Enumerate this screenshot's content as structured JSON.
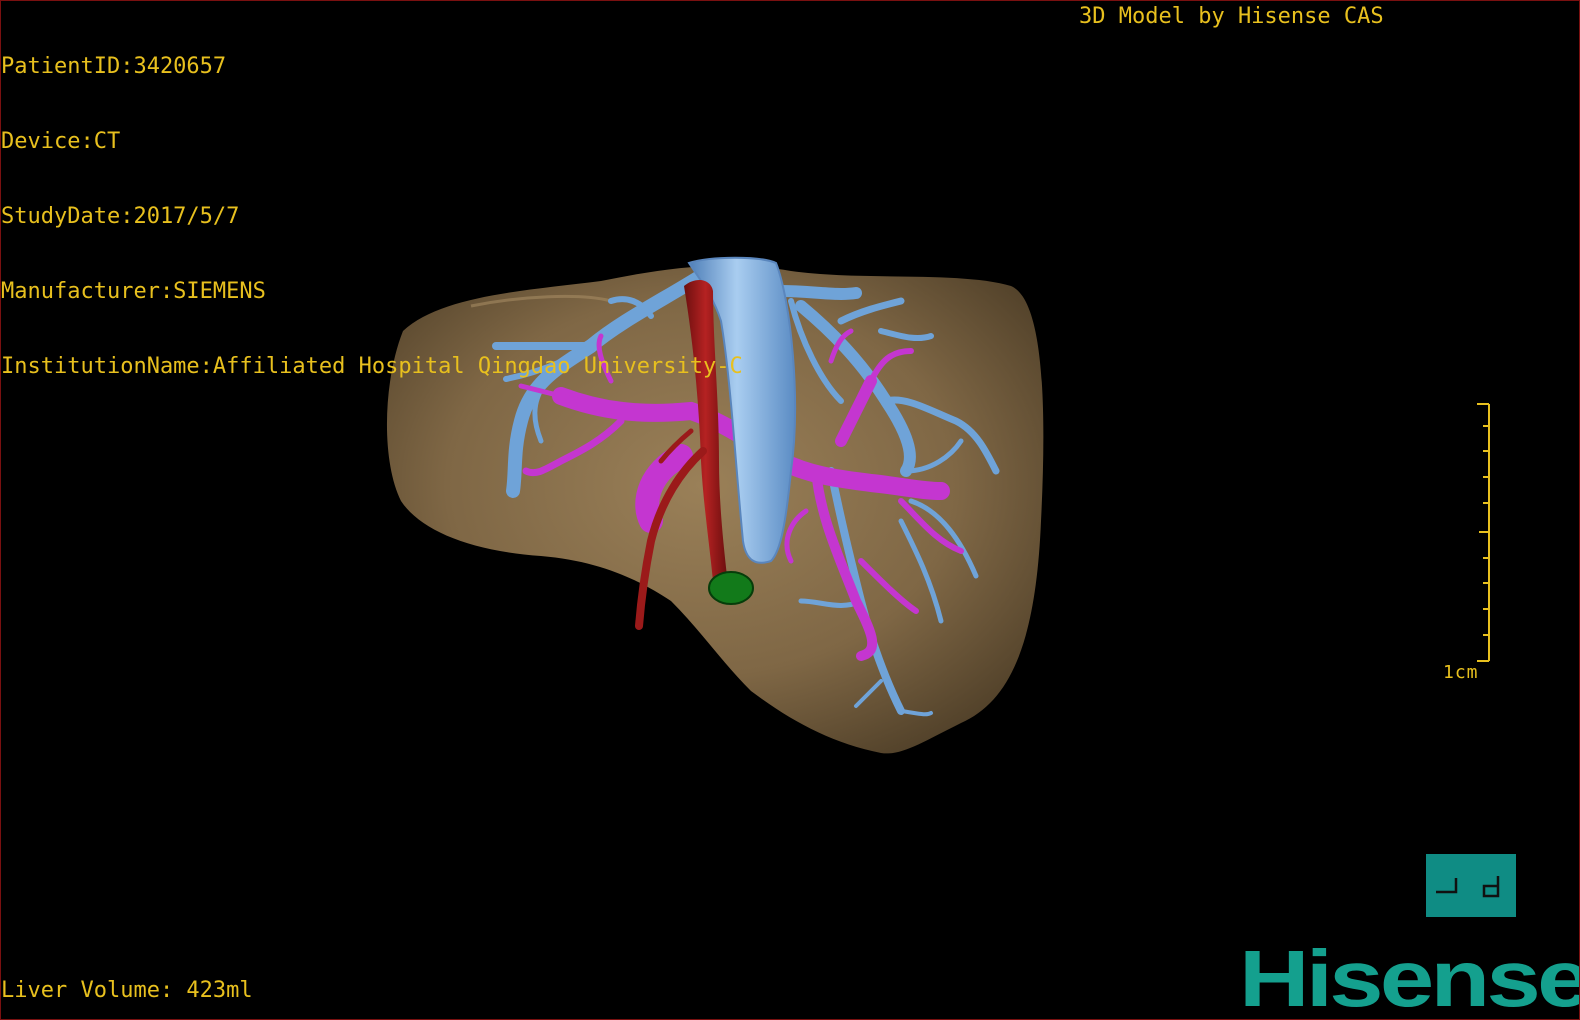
{
  "patient_info": {
    "patient_id": "PatientID:3420657",
    "device": "Device:CT",
    "study_date": "StudyDate:2017/5/7",
    "manufacturer": "Manufacturer:SIEMENS",
    "institution": "InstitutionName:Affiliated Hospital Qingdao University-C"
  },
  "header": {
    "title": "3D Model by Hisense CAS"
  },
  "footer": {
    "liver_volume": "Liver Volume: 423ml"
  },
  "scale_bar": {
    "label": "1cm"
  },
  "orientation": {
    "glyph": "ㅢ d"
  },
  "brand": {
    "logo_text": "Hisense"
  },
  "colors": {
    "overlay_text": "#e8c01e",
    "liver": "#8a7250",
    "hepatic_vein": "#6fa3d8",
    "portal_vein": "#c436d0",
    "artery": "#9b1a1a",
    "gallbladder": "#127a1a",
    "brand": "#14a08e"
  }
}
